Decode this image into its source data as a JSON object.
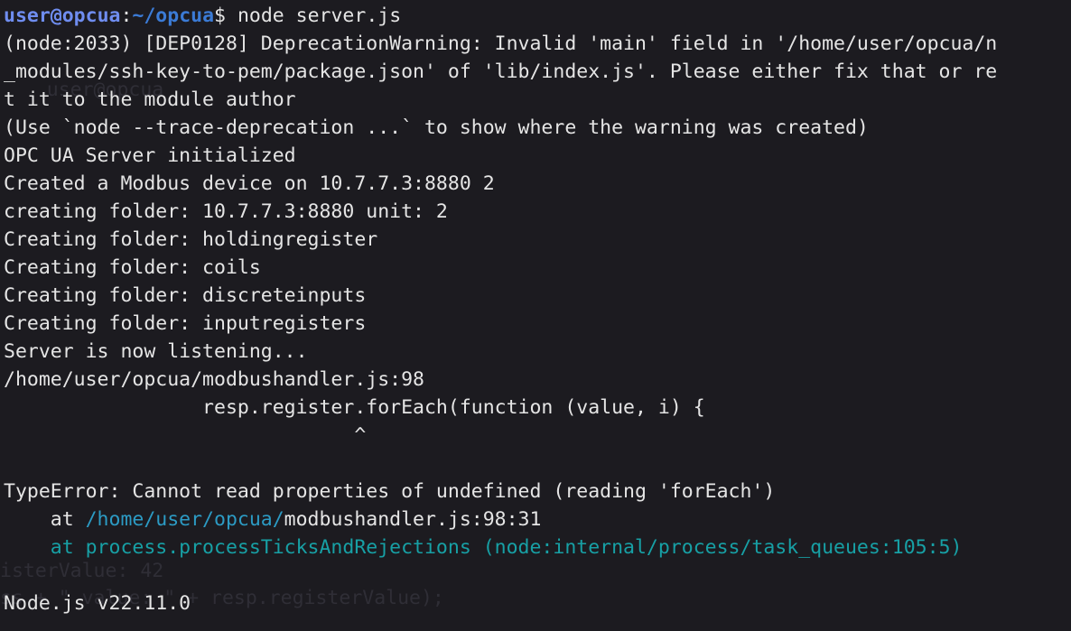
{
  "prompt": {
    "user": "user",
    "at": "@",
    "host": "opcua",
    "colon": ":",
    "cwd": "~/opcua",
    "symbol": "$",
    "command": "node server.js"
  },
  "output": {
    "l1": "(node:2033) [DEP0128] DeprecationWarning: Invalid 'main' field in '/home/user/opcua/n",
    "l2": "_modules/ssh-key-to-pem/package.json' of 'lib/index.js'. Please either fix that or re",
    "l3": "t it to the module author",
    "l4": "(Use `node --trace-deprecation ...` to show where the warning was created)",
    "l5": "OPC UA Server initialized",
    "l6": "Created a Modbus device on 10.7.7.3:8880 2",
    "l7": "creating folder: 10.7.7.3:8880 unit: 2",
    "l8": "Creating folder: holdingregister",
    "l9": "Creating folder: coils",
    "l10": "Creating folder: discreteinputs",
    "l11": "Creating folder: inputregisters",
    "l12": "Server is now listening...",
    "l13": "/home/user/opcua/modbushandler.js:98",
    "l14": "                 resp.register.forEach(function (value, i) {",
    "l15": "                              ^",
    "l16": "",
    "l17": "TypeError: Cannot read properties of undefined (reading 'forEach')",
    "stack1": {
      "prefix": "    at ",
      "path": "/home/user/opcua/",
      "file": "modbushandler.js:98:31"
    },
    "stack2": "    at process.processTicksAndRejections (node:internal/process/task_queues:105:5)",
    "l20": "",
    "version": "Node.js v22.11.0"
  },
  "ghost_text": {
    "g1": "    user@opcua",
    "g2": "isterValue: 42 ",
    "g3": "ss + \" value: \" + resp.registerValue);"
  }
}
